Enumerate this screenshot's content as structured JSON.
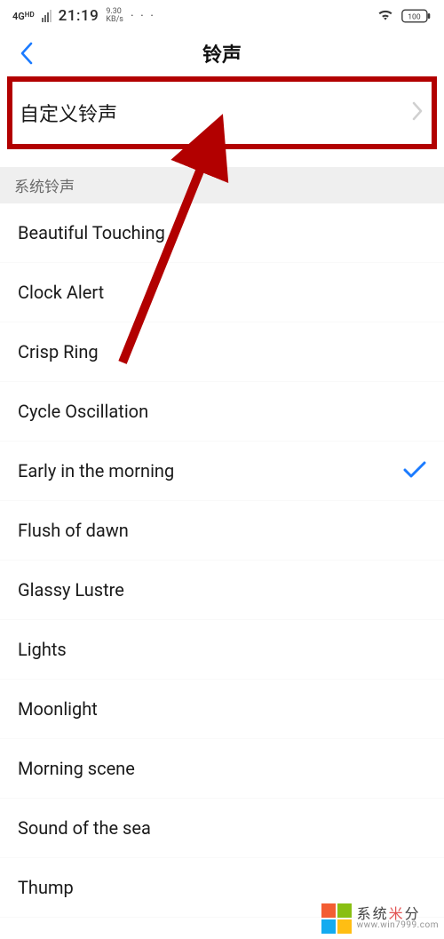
{
  "statusbar": {
    "network_label": "4G",
    "network_hd": "HD",
    "time": "21:19",
    "speed_top": "9.30",
    "speed_bottom": "KB/s",
    "dots": "· · ·",
    "battery_level": "100"
  },
  "header": {
    "title": "铃声"
  },
  "custom": {
    "label": "自定义铃声"
  },
  "section": {
    "system_ringtones": "系统铃声"
  },
  "ringtones": [
    {
      "name": "Beautiful Touching",
      "selected": false
    },
    {
      "name": "Clock Alert",
      "selected": false
    },
    {
      "name": "Crisp Ring",
      "selected": false
    },
    {
      "name": "Cycle Oscillation",
      "selected": false
    },
    {
      "name": "Early in the morning",
      "selected": true
    },
    {
      "name": "Flush of dawn",
      "selected": false
    },
    {
      "name": "Glassy Lustre",
      "selected": false
    },
    {
      "name": "Lights",
      "selected": false
    },
    {
      "name": "Moonlight",
      "selected": false
    },
    {
      "name": "Morning scene",
      "selected": false
    },
    {
      "name": "Sound of the sea",
      "selected": false
    },
    {
      "name": "Thump",
      "selected": false
    }
  ],
  "watermark": {
    "brand_prefix": "系统",
    "brand_accent": "米",
    "brand_suffix": "分",
    "url": "www.win7999.com"
  }
}
